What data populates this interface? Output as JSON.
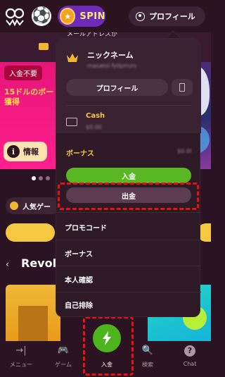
{
  "header": {
    "spin_label": "SPIN",
    "profile_label": "プロフィール",
    "soccer_icon": "⚽"
  },
  "background": {
    "mail_notice": "メールアドレスが",
    "promo_badge": "入金不要",
    "promo_text": "15ドルのボー\n獲得",
    "info_button": "情報",
    "popular_label": "人気ゲー",
    "section_title": "Revolu"
  },
  "dropdown": {
    "nickname_label": "ニックネーム",
    "nickname_value": "masatol fyllprrurs",
    "profile_button": "プロフィール",
    "cash_label": "Cash",
    "cash_value": "$0.00",
    "bonus_label": "ボーナス",
    "bonus_value": "$0.00",
    "deposit_button": "入金",
    "withdraw_button": "出金",
    "menu": [
      {
        "label": "プロモコード"
      },
      {
        "label": "ボーナス"
      },
      {
        "label": "本人確認"
      },
      {
        "label": "自己排除"
      }
    ]
  },
  "bottom_nav": {
    "items": [
      {
        "label": "メニュー",
        "icon": "→|"
      },
      {
        "label": "ゲーム",
        "icon": "🎮"
      },
      {
        "label": "入金",
        "icon": "lightning"
      },
      {
        "label": "検索",
        "icon": "🔍"
      },
      {
        "label": "Chat",
        "icon": "?"
      }
    ]
  },
  "colors": {
    "accent_green": "#58b723",
    "accent_yellow": "#f6c842",
    "highlight_red": "#e8110f",
    "spin_purple": "#6d2bb8"
  }
}
